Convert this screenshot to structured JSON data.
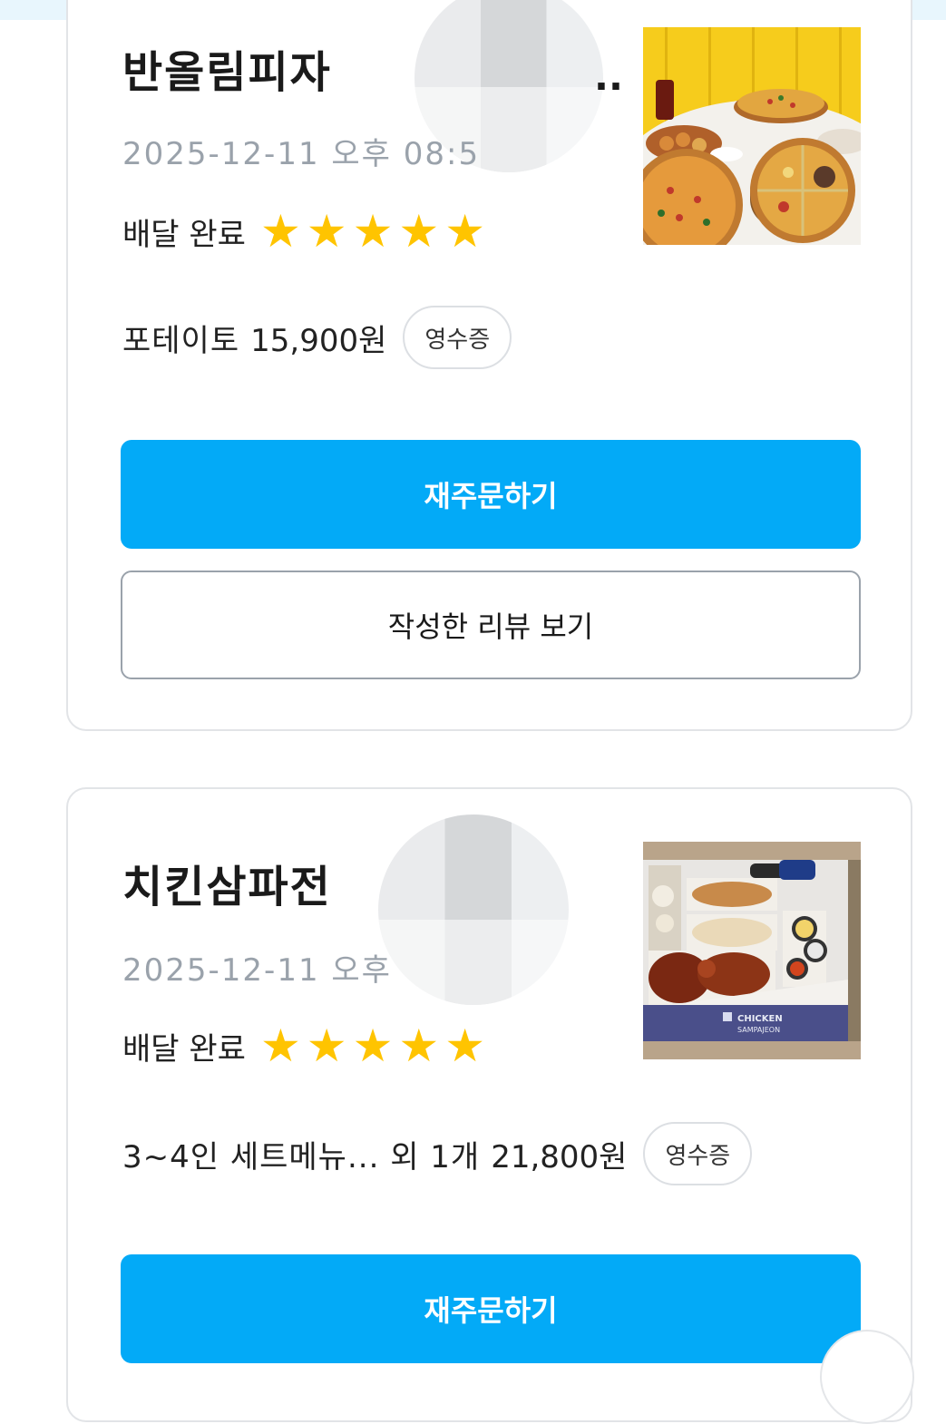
{
  "orders": [
    {
      "store": "반올림피자",
      "datetime": "2025-12-11 오후 08:5",
      "status": "배달 완료",
      "rating": 5,
      "summary": "포테이토",
      "price": "15,900원",
      "receipt_label": "영수증",
      "reorder_label": "재주문하기",
      "review_label": "작성한 리뷰 보기"
    },
    {
      "store": "치킨삼파전",
      "datetime": "2025-12-11 오후",
      "status": "배달 완료",
      "rating": 5,
      "summary": "3~4인 세트메뉴... 외 1개",
      "price": "21,800원",
      "receipt_label": "영수증",
      "reorder_label": "재주문하기"
    }
  ],
  "truncation": "..",
  "colors": {
    "accent": "#03aaf7",
    "star": "#ffc400",
    "muted": "#9aa2ab"
  }
}
